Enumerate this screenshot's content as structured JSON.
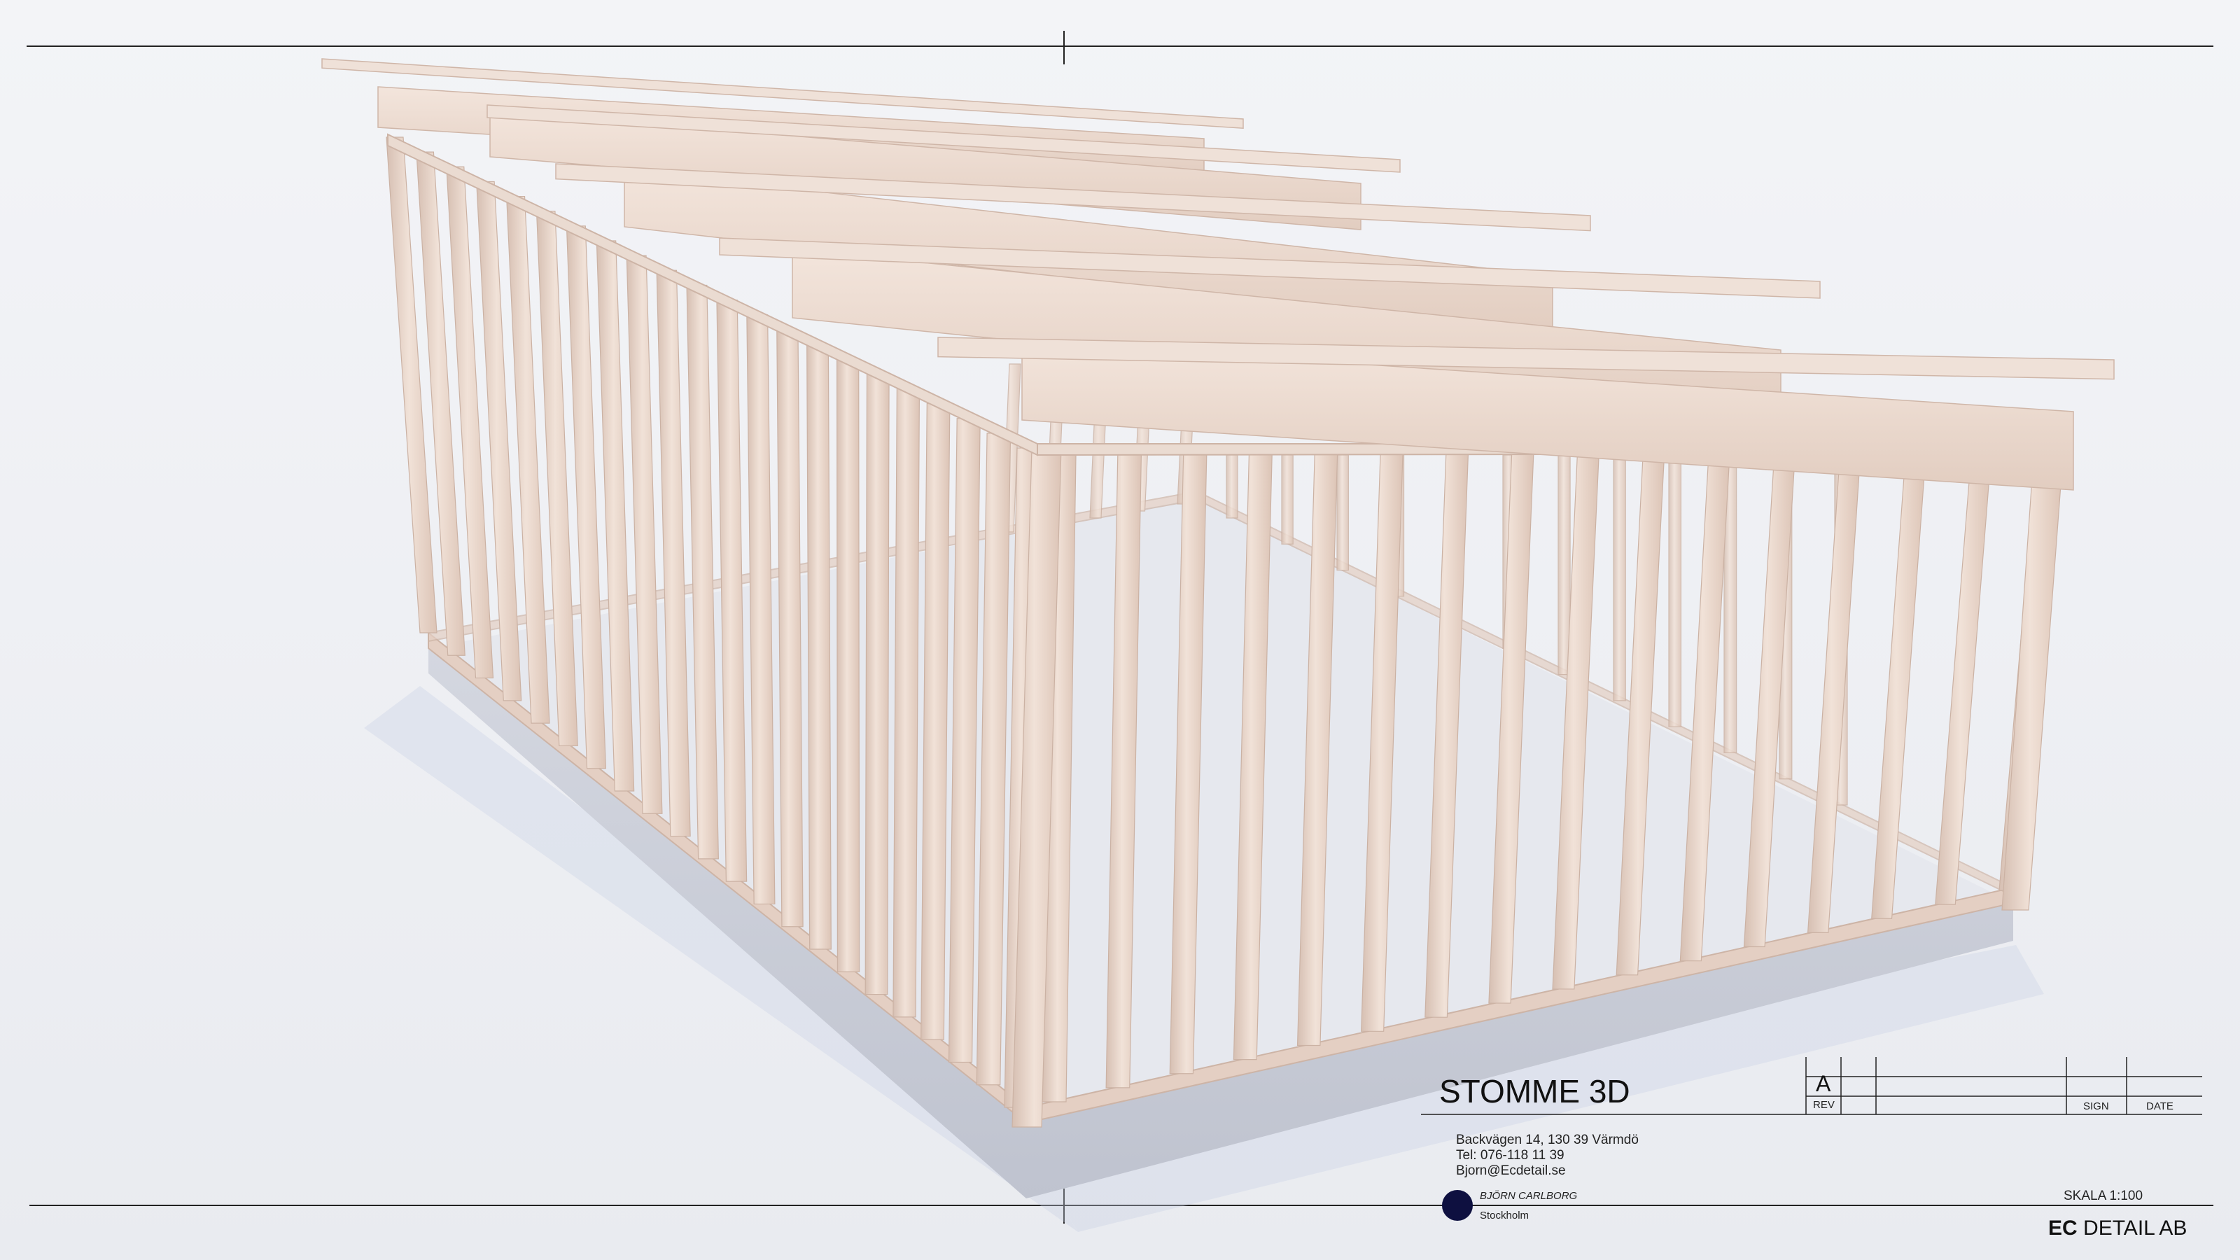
{
  "drawing": {
    "title": "STOMME 3D",
    "address": "Backvägen 14, 130 39 Värmdö",
    "phone": "Tel: 076-118 11 39",
    "email": "Bjorn@Ecdetail.se",
    "author": "BJÖRN CARLBORG",
    "city": "Stockholm",
    "scale": "SKALA 1:100",
    "company_bold": "EC",
    "company_rest": "DETAIL AB"
  },
  "revision_table": {
    "rev_value": "A",
    "rev_label": "REV",
    "sign_label": "SIGN",
    "date_label": "DATE"
  },
  "colors": {
    "background": "#eef0f4",
    "timber": "#ecd9ce",
    "timber_shade": "#d8c0b2",
    "slab": "#c9ccd6",
    "logo": "#0e1040",
    "lines": "#222222"
  }
}
